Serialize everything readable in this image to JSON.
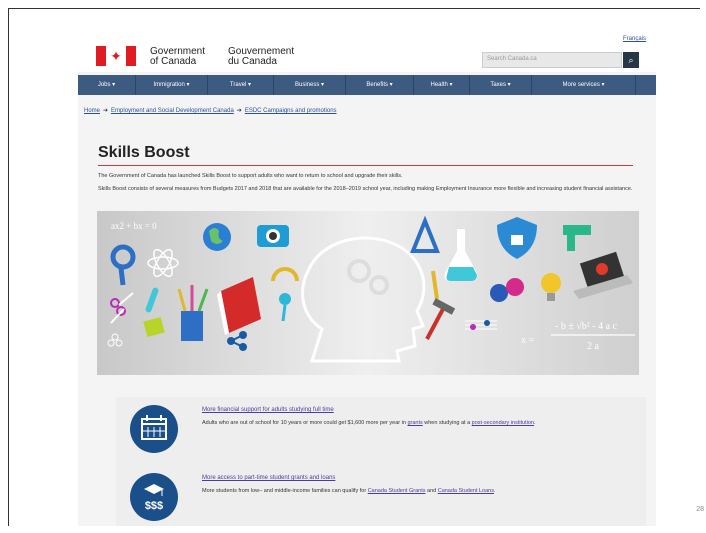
{
  "header": {
    "language_link": "Français",
    "gov_en_line1": "Government",
    "gov_en_line2": "of Canada",
    "gov_fr_line1": "Gouvernement",
    "gov_fr_line2": "du Canada",
    "search_placeholder": "Search Canada.ca"
  },
  "nav": {
    "items": [
      {
        "label": "Jobs ▾"
      },
      {
        "label": "Immigration ▾"
      },
      {
        "label": "Travel ▾"
      },
      {
        "label": "Business ▾"
      },
      {
        "label": "Benefits ▾"
      },
      {
        "label": "Health ▾"
      },
      {
        "label": "Taxes ▾"
      },
      {
        "label": "More services ▾"
      }
    ]
  },
  "breadcrumb": {
    "items": [
      "Home",
      "Employment and Social Development Canada",
      "ESDC Campaigns and promotions"
    ],
    "separator": "➔"
  },
  "main": {
    "title": "Skills Boost",
    "para1": "The Government of Canada has launched Skills Boost to support adults who want to return to school and upgrade their skills.",
    "para2": "Skills Boost consists of several measures from Budgets 2017 and 2018 that are available for the 2018–2019 school year, including making Employment Insurance more flexible and increasing student financial assistance."
  },
  "banner": {
    "formula_top": "ax2 + bx = 0",
    "formula_bottom_x": "x =",
    "formula_numer": "- b ± √b² - 4 a c",
    "formula_denom": "2 a"
  },
  "cards": [
    {
      "title": "More financial support for adults studying full time",
      "text_before": "Adults who are out of school for 10 years or more could get $1,600 more per year in ",
      "link1": "grants",
      "text_middle": " when studying at a ",
      "link2": "post-secondary institution",
      "text_after": "."
    },
    {
      "title": "More access to part-time student grants and loans",
      "text_before": "More students from low– and middle-income families can qualify for ",
      "link1": "Canada Student Grants",
      "text_middle": " and ",
      "link2": "Canada Student Loans",
      "text_after": ".",
      "icon_symbol": "$$$"
    }
  ],
  "slide_number": "28",
  "colors": {
    "nav_bg": "#3d5a80",
    "flag_red": "#e01b22",
    "title_rule": "#c43d3d",
    "card_icon": "#1a4f8a",
    "link": "#2a4fa0"
  }
}
